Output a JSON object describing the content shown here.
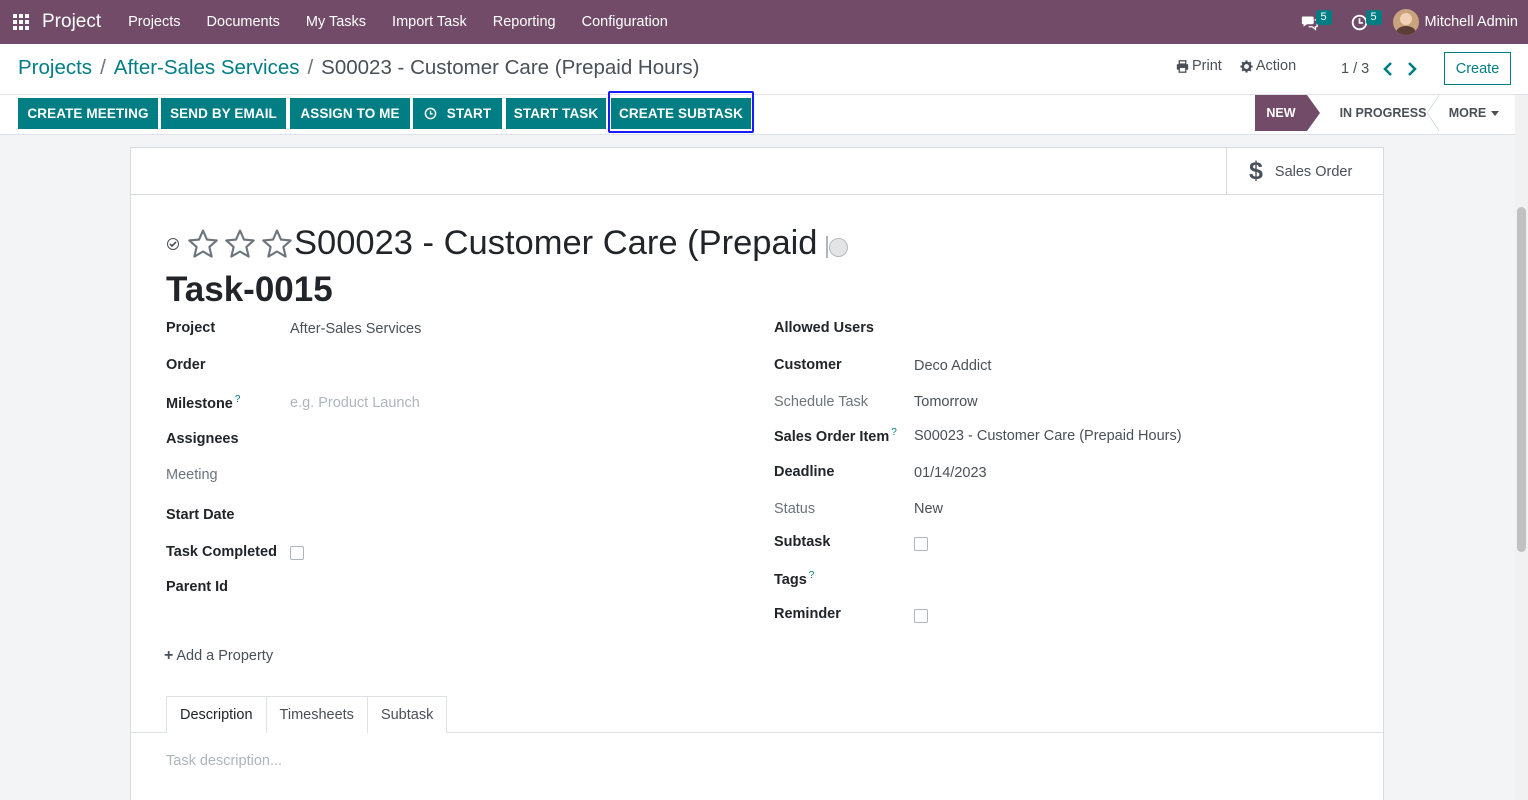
{
  "app": {
    "brand": "Project",
    "menu": [
      "Projects",
      "Documents",
      "My Tasks",
      "Import Task",
      "Reporting",
      "Configuration"
    ],
    "messages_count": "5",
    "activities_count": "5",
    "user_name": "Mitchell Admin"
  },
  "breadcrumb": {
    "root": "Projects",
    "sep1": "/",
    "project": "After-Sales Services",
    "sep2": "/",
    "current": "S00023 - Customer Care (Prepaid Hours)"
  },
  "control": {
    "print_label": "Print",
    "action_label": "Action",
    "pager": "1 / 3",
    "create_label": "Create"
  },
  "actions": {
    "create_meeting": "CREATE MEETING",
    "send_by_email": "SEND BY EMAIL",
    "assign_to_me": "ASSIGN TO ME",
    "start": "START",
    "start_task": "START TASK",
    "create_subtask": "CREATE SUBTASK"
  },
  "stages": {
    "new": "NEW",
    "in_progress": "IN PROGRESS",
    "more": "MORE"
  },
  "smart_buttons": {
    "sales_order": "Sales Order"
  },
  "task": {
    "title": "S00023 - Customer Care (Prepaid Hours)",
    "number": "Task-0015",
    "priority_stars": 0
  },
  "fields_left": {
    "project_label": "Project",
    "project_value": "After-Sales Services",
    "order_label": "Order",
    "milestone_label": "Milestone",
    "milestone_help": "?",
    "milestone_placeholder": "e.g. Product Launch",
    "assignees_label": "Assignees",
    "meeting_label": "Meeting",
    "start_date_label": "Start Date",
    "task_completed_label": "Task Completed",
    "parent_id_label": "Parent Id"
  },
  "fields_right": {
    "allowed_users_label": "Allowed Users",
    "customer_label": "Customer",
    "customer_value": "Deco Addict",
    "schedule_task_label": "Schedule Task",
    "schedule_task_value": "Tomorrow",
    "sales_order_item_label": "Sales Order Item",
    "sales_order_item_help": "?",
    "sales_order_item_value": "S00023 - Customer Care (Prepaid Hours)",
    "deadline_label": "Deadline",
    "deadline_value": "01/14/2023",
    "status_label": "Status",
    "status_value": "New",
    "subtask_label": "Subtask",
    "tags_label": "Tags",
    "tags_help": "?",
    "reminder_label": "Reminder"
  },
  "add_property": "Add a Property",
  "tabs": [
    "Description",
    "Timesheets",
    "Subtask"
  ],
  "description_placeholder": "Task description..."
}
